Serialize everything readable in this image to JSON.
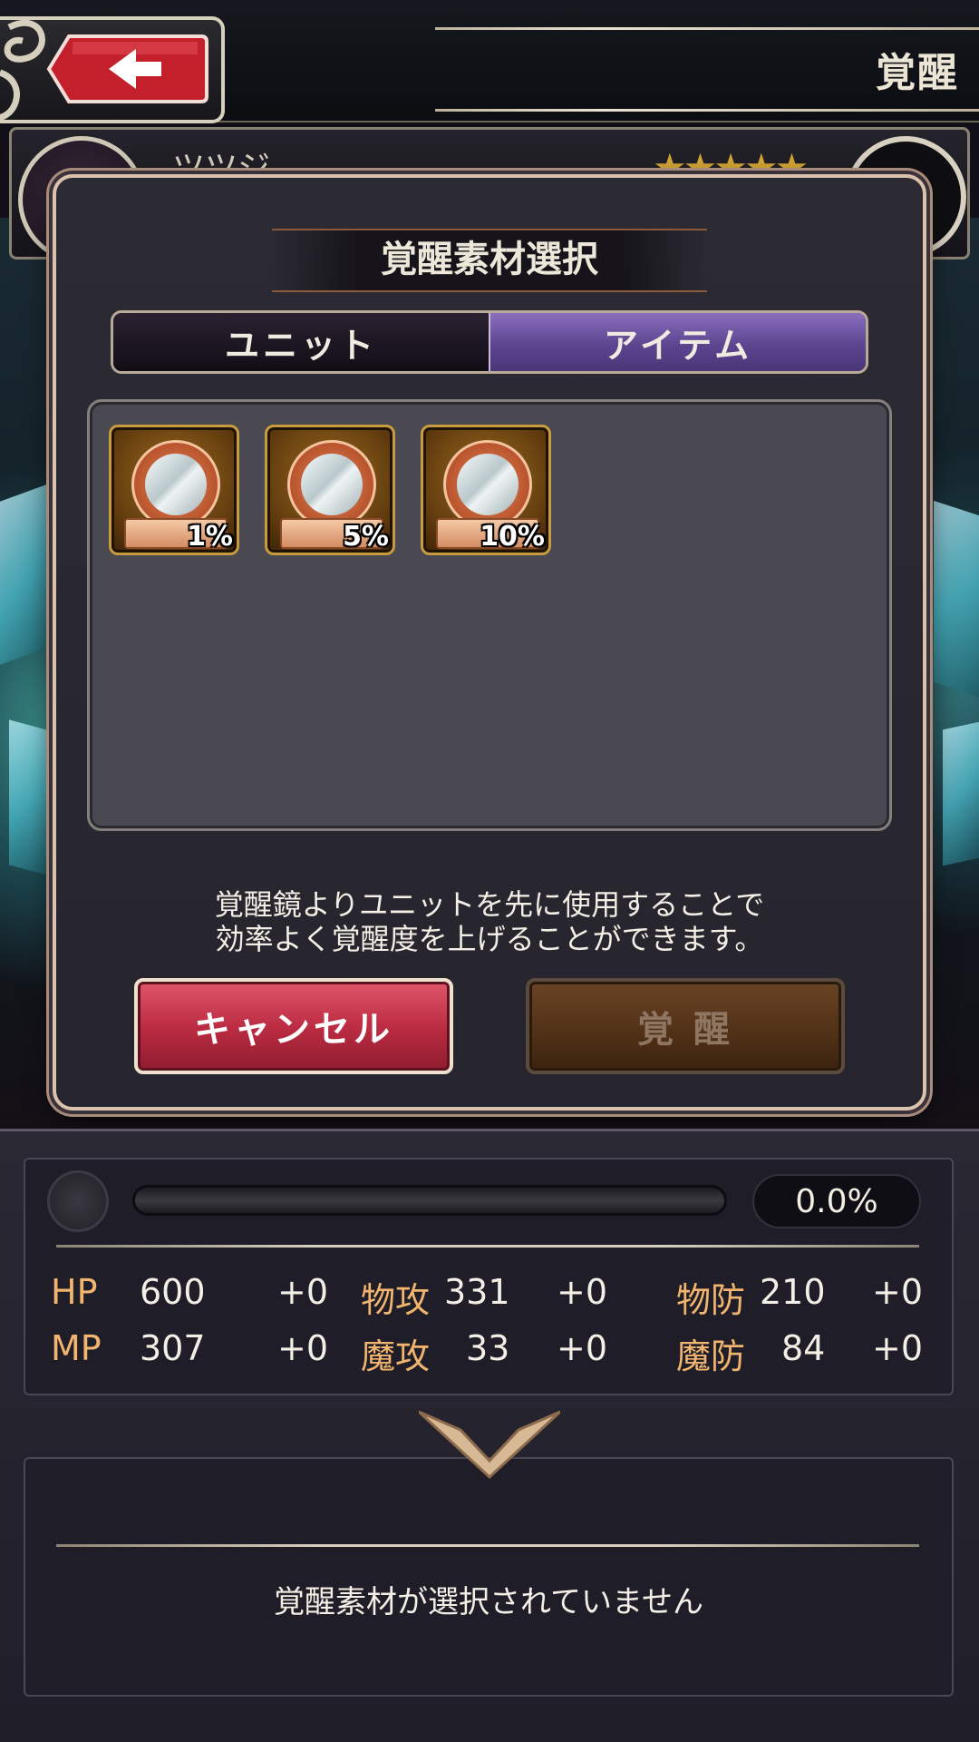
{
  "header": {
    "title": "覚醒",
    "back_icon": "arrow-left-icon"
  },
  "unit": {
    "name": "ツツジ",
    "stars": "★★★★★",
    "rarity_color": "#d3a535"
  },
  "modal": {
    "title": "覚醒素材選択",
    "tabs": [
      {
        "label": "ユニット",
        "active": false
      },
      {
        "label": "アイテム",
        "active": true
      }
    ],
    "items": [
      {
        "icon": "awakening-mirror-icon",
        "percent": "1%"
      },
      {
        "icon": "awakening-mirror-icon",
        "percent": "5%"
      },
      {
        "icon": "awakening-mirror-icon",
        "percent": "10%"
      }
    ],
    "notice_line1": "覚醒鏡よりユニットを先に使用することで",
    "notice_line2": "効率よく覚醒度を上げることができます。",
    "cancel_label": "キャンセル",
    "awaken_label": "覚 醒",
    "active_tab_color": "#5d4590",
    "cancel_color": "#bd2d43"
  },
  "status": {
    "progress_text": "0.0%",
    "progress_fraction": 0.0,
    "stats": [
      {
        "label": "HP",
        "value": "600",
        "bonus": "+0"
      },
      {
        "label": "MP",
        "value": "307",
        "bonus": "+0"
      },
      {
        "label": "物攻",
        "value": "331",
        "bonus": "+0"
      },
      {
        "label": "魔攻",
        "value": "33",
        "bonus": "+0"
      },
      {
        "label": "物防",
        "value": "210",
        "bonus": "+0"
      },
      {
        "label": "魔防",
        "value": "84",
        "bonus": "+0"
      }
    ],
    "label_color": "#f1b56f",
    "empty_message": "覚醒素材が選択されていません"
  }
}
